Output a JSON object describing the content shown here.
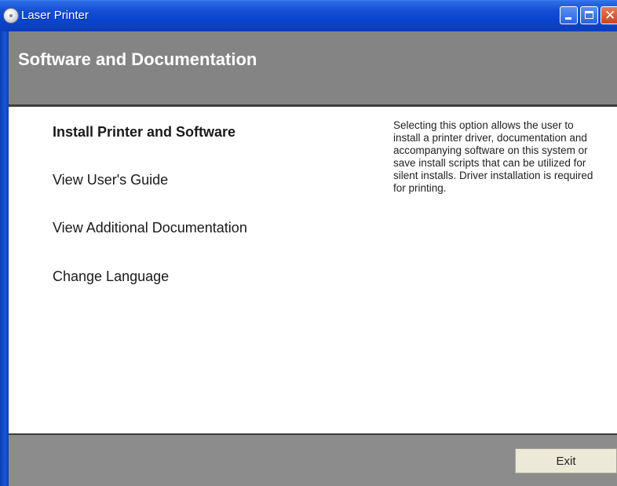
{
  "window": {
    "title": "Laser Printer",
    "icon": "cd-disc-icon",
    "controls": [
      "minimize",
      "maximize",
      "close"
    ],
    "close_glyph": "✕"
  },
  "header": {
    "title": "Software and Documentation"
  },
  "menu": {
    "items": [
      {
        "label": "Install Printer and Software",
        "selected": true
      },
      {
        "label": "View User's Guide",
        "selected": false
      },
      {
        "label": "View Additional Documentation",
        "selected": false
      },
      {
        "label": "Change Language",
        "selected": false
      }
    ]
  },
  "description": "Selecting this option allows the user to install a printer driver, documentation and accompanying software on this system or save install scripts that can be utilized for silent installs. Driver installation is required for printing.",
  "footer": {
    "exit_label": "Exit"
  },
  "colors": {
    "titlebar_blue": "#0a45d0",
    "header_gray": "#848484",
    "footer_gray": "#8c8c8c",
    "button_face": "#ece9d8"
  }
}
